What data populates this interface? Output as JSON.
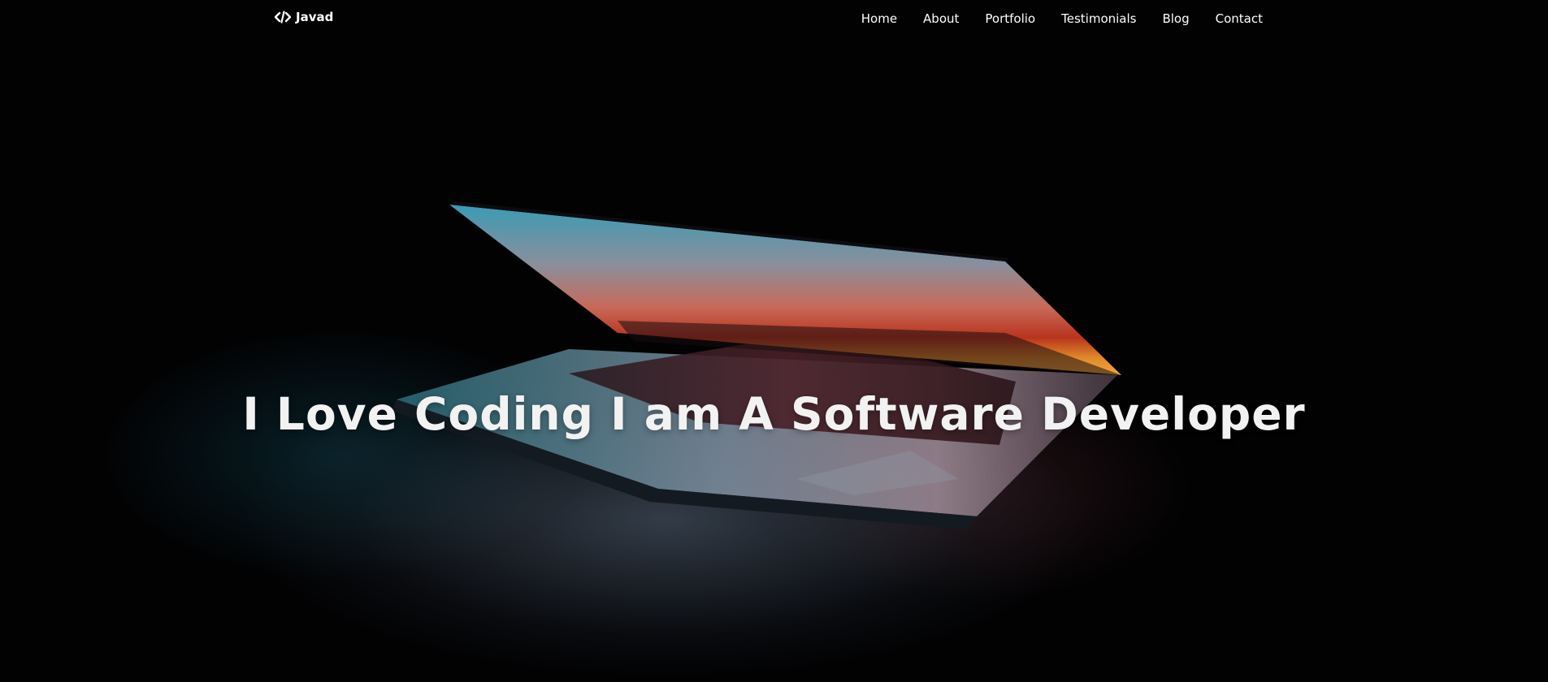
{
  "navbar": {
    "brand_name": "Javad",
    "brand_icon": "code-icon",
    "links": [
      {
        "label": "Home"
      },
      {
        "label": "About"
      },
      {
        "label": "Portfolio"
      },
      {
        "label": "Testimonials"
      },
      {
        "label": "Blog"
      },
      {
        "label": "Contact"
      }
    ]
  },
  "hero": {
    "headline": "I Love Coding I am A Software Developer",
    "background": "laptop-photo"
  },
  "colors": {
    "background": "#020203",
    "text": "#ffffff"
  }
}
